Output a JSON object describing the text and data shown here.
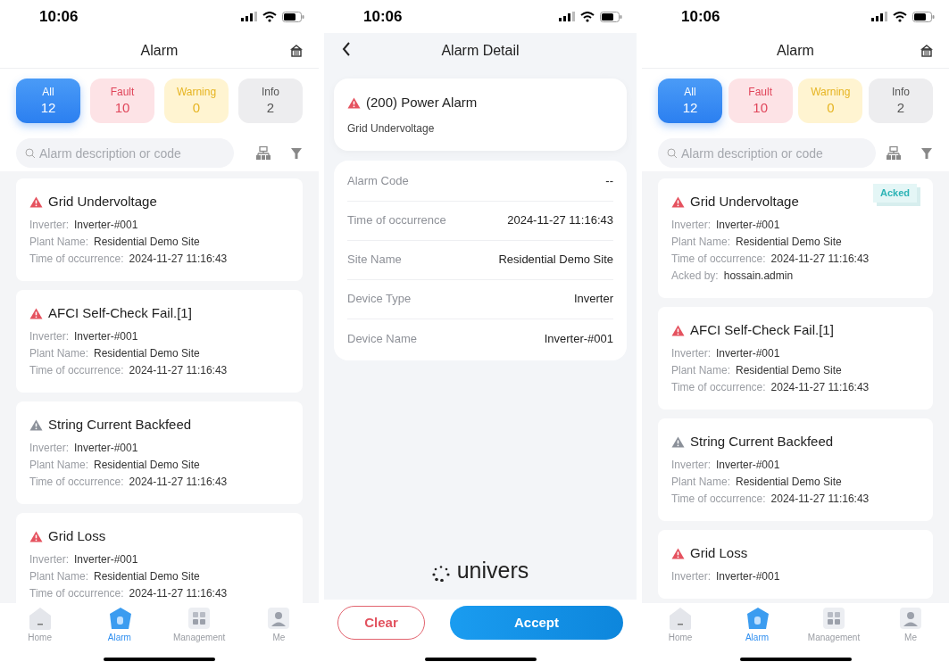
{
  "screens": [
    {
      "kind": "alarm_list",
      "status_bar": {
        "time": "10:06"
      },
      "title": "Alarm",
      "filters": [
        {
          "kind": "all",
          "label": "All",
          "count": "12",
          "selected": true
        },
        {
          "kind": "fault",
          "label": "Fault",
          "count": "10",
          "selected": false
        },
        {
          "kind": "warning",
          "label": "Warning",
          "count": "0",
          "selected": false
        },
        {
          "kind": "info",
          "label": "Info",
          "count": "2",
          "selected": false
        }
      ],
      "search": {
        "placeholder": "Alarm description or code"
      },
      "alarms": [
        {
          "color": "#e5525f",
          "title": "Grid Undervoltage",
          "fields": [
            {
              "label": "Inverter:",
              "value": "Inverter-#001"
            },
            {
              "label": "Plant Name:",
              "value": "Residential Demo Site"
            },
            {
              "label": "Time of occurrence:",
              "value": "2024-11-27 11:16:43"
            }
          ]
        },
        {
          "color": "#e5525f",
          "title": "AFCI Self-Check Fail.[1]",
          "fields": [
            {
              "label": "Inverter:",
              "value": "Inverter-#001"
            },
            {
              "label": "Plant Name:",
              "value": "Residential Demo Site"
            },
            {
              "label": "Time of occurrence:",
              "value": "2024-11-27 11:16:43"
            }
          ]
        },
        {
          "color": "#8b9099",
          "title": "String Current Backfeed",
          "fields": [
            {
              "label": "Inverter:",
              "value": "Inverter-#001"
            },
            {
              "label": "Plant Name:",
              "value": "Residential Demo Site"
            },
            {
              "label": "Time of occurrence:",
              "value": "2024-11-27 11:16:43"
            }
          ]
        },
        {
          "color": "#e5525f",
          "title": "Grid Loss",
          "fields": [
            {
              "label": "Inverter:",
              "value": "Inverter-#001"
            },
            {
              "label": "Plant Name:",
              "value": "Residential Demo Site"
            },
            {
              "label": "Time of occurrence:",
              "value": "2024-11-27 11:16:43"
            }
          ]
        }
      ],
      "nav": [
        {
          "kind": "home",
          "label": "Home",
          "selected": false
        },
        {
          "kind": "alarm",
          "label": "Alarm",
          "selected": true
        },
        {
          "kind": "management",
          "label": "Management",
          "selected": false
        },
        {
          "kind": "me",
          "label": "Me",
          "selected": false
        }
      ]
    },
    {
      "kind": "alarm_detail",
      "status_bar": {
        "time": "10:06"
      },
      "title": "Alarm Detail",
      "summary": {
        "color": "#e5525f",
        "title": "(200) Power Alarm",
        "subtitle": "Grid Undervoltage"
      },
      "rows": [
        {
          "label": "Alarm Code",
          "value": "--"
        },
        {
          "label": "Time of occurrence",
          "value": "2024-11-27 11:16:43"
        },
        {
          "label": "Site Name",
          "value": "Residential Demo Site"
        },
        {
          "label": "Device Type",
          "value": "Inverter"
        },
        {
          "label": "Device Name",
          "value": "Inverter-#001"
        }
      ],
      "logo": "univers",
      "buttons": [
        {
          "kind": "secondary",
          "label": "Clear"
        },
        {
          "kind": "primary",
          "label": "Accept"
        }
      ]
    },
    {
      "kind": "alarm_list",
      "status_bar": {
        "time": "10:06"
      },
      "title": "Alarm",
      "filters": [
        {
          "kind": "all",
          "label": "All",
          "count": "12",
          "selected": true
        },
        {
          "kind": "fault",
          "label": "Fault",
          "count": "10",
          "selected": false
        },
        {
          "kind": "warning",
          "label": "Warning",
          "count": "0",
          "selected": false
        },
        {
          "kind": "info",
          "label": "Info",
          "count": "2",
          "selected": false
        }
      ],
      "search": {
        "placeholder": "Alarm description or code"
      },
      "alarms": [
        {
          "color": "#e5525f",
          "title": "Grid Undervoltage",
          "badge": "Acked",
          "fields": [
            {
              "label": "Inverter:",
              "value": "Inverter-#001"
            },
            {
              "label": "Plant Name:",
              "value": "Residential Demo Site"
            },
            {
              "label": "Time of occurrence:",
              "value": "2024-11-27 11:16:43"
            },
            {
              "label": "Acked by:",
              "value": "hossain.admin"
            }
          ]
        },
        {
          "color": "#e5525f",
          "title": "AFCI Self-Check Fail.[1]",
          "fields": [
            {
              "label": "Inverter:",
              "value": "Inverter-#001"
            },
            {
              "label": "Plant Name:",
              "value": "Residential Demo Site"
            },
            {
              "label": "Time of occurrence:",
              "value": "2024-11-27 11:16:43"
            }
          ]
        },
        {
          "color": "#8b9099",
          "title": "String Current Backfeed",
          "fields": [
            {
              "label": "Inverter:",
              "value": "Inverter-#001"
            },
            {
              "label": "Plant Name:",
              "value": "Residential Demo Site"
            },
            {
              "label": "Time of occurrence:",
              "value": "2024-11-27 11:16:43"
            }
          ]
        },
        {
          "color": "#e5525f",
          "title": "Grid Loss",
          "fields": [
            {
              "label": "Inverter:",
              "value": "Inverter-#001"
            }
          ]
        }
      ],
      "nav": [
        {
          "kind": "home",
          "label": "Home",
          "selected": false
        },
        {
          "kind": "alarm",
          "label": "Alarm",
          "selected": true
        },
        {
          "kind": "management",
          "label": "Management",
          "selected": false
        },
        {
          "kind": "me",
          "label": "Me",
          "selected": false
        }
      ]
    }
  ]
}
